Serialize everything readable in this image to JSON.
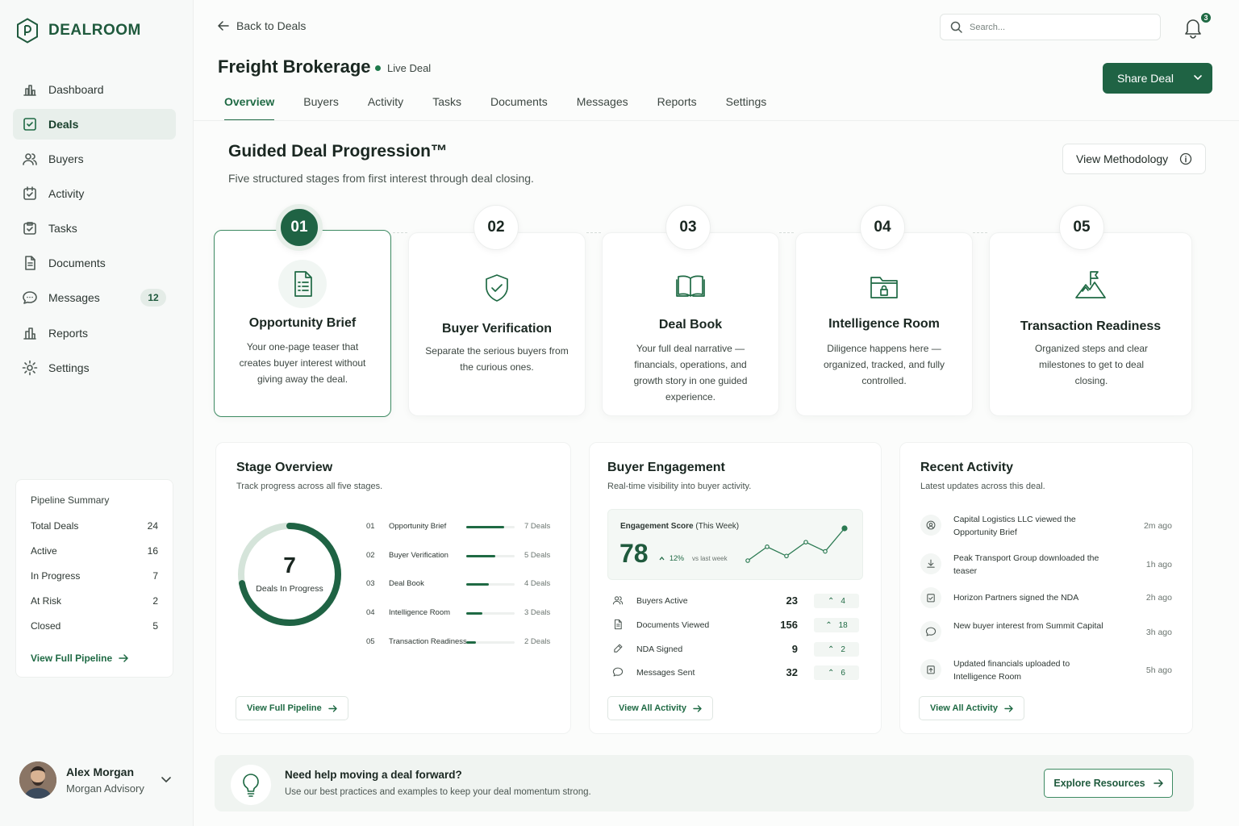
{
  "brand": {
    "name": "DEALROOM"
  },
  "sidebar": {
    "items": [
      {
        "label": "Dashboard",
        "icon": "chart-icon"
      },
      {
        "label": "Deals",
        "icon": "deal-check-icon",
        "active": true
      },
      {
        "label": "Buyers",
        "icon": "users-icon"
      },
      {
        "label": "Activity",
        "icon": "activity-icon"
      },
      {
        "label": "Tasks",
        "icon": "tasks-icon"
      },
      {
        "label": "Documents",
        "icon": "document-icon"
      },
      {
        "label": "Messages",
        "icon": "message-icon",
        "badge": "12"
      },
      {
        "label": "Reports",
        "icon": "reports-icon"
      },
      {
        "label": "Settings",
        "icon": "gear-icon"
      }
    ],
    "pipeline": {
      "title": "Pipeline Summary",
      "rows": [
        {
          "label": "Total Deals",
          "value": "24"
        },
        {
          "label": "Active",
          "value": "16"
        },
        {
          "label": "In Progress",
          "value": "7"
        },
        {
          "label": "At Risk",
          "value": "2"
        },
        {
          "label": "Closed",
          "value": "5"
        }
      ],
      "link": "View Full Pipeline"
    },
    "user": {
      "name": "Alex Morgan",
      "org": "Morgan Advisory"
    }
  },
  "header": {
    "back": "Back to Deals",
    "search_placeholder": "Search...",
    "notifications": "3",
    "title": "Freight Brokerage",
    "status": "Live Deal",
    "share": "Share Deal",
    "tabs": [
      "Overview",
      "Buyers",
      "Activity",
      "Tasks",
      "Documents",
      "Messages",
      "Reports",
      "Settings"
    ],
    "active_tab": "Overview"
  },
  "guided": {
    "title": "Guided Deal Progression™",
    "subtitle": "Five structured stages from first interest through deal closing.",
    "methodology": "View Methodology",
    "stages": [
      {
        "num": "01",
        "name": "Opportunity Brief",
        "desc": "Your one-page teaser that creates buyer interest without giving away the deal.",
        "icon": "brief-document-icon"
      },
      {
        "num": "02",
        "name": "Buyer Verification",
        "desc": "Separate the serious buyers from the curious ones.",
        "icon": "shield-check-icon"
      },
      {
        "num": "03",
        "name": "Deal Book",
        "desc": "Your full deal narrative — financials, operations, and growth story in one guided experience.",
        "icon": "open-book-icon"
      },
      {
        "num": "04",
        "name": "Intelligence Room",
        "desc": "Diligence happens here — organized, tracked, and fully controlled.",
        "icon": "locked-folder-icon"
      },
      {
        "num": "05",
        "name": "Transaction Readiness",
        "desc": "Organized steps and clear milestones to get to deal closing.",
        "icon": "mountain-flag-icon"
      }
    ]
  },
  "stage_overview": {
    "title": "Stage Overview",
    "subtitle": "Track progress across all five stages.",
    "donut": {
      "value": "7",
      "label": "Deals In Progress",
      "fraction": 0.72
    },
    "rows": [
      {
        "num": "01",
        "label": "Opportunity Brief",
        "count": "7 Deals",
        "fraction": 0.78
      },
      {
        "num": "02",
        "label": "Buyer Verification",
        "count": "5 Deals",
        "fraction": 0.6
      },
      {
        "num": "03",
        "label": "Deal Book",
        "count": "4 Deals",
        "fraction": 0.47
      },
      {
        "num": "04",
        "label": "Intelligence Room",
        "count": "3 Deals",
        "fraction": 0.33
      },
      {
        "num": "05",
        "label": "Transaction Readiness",
        "count": "2 Deals",
        "fraction": 0.2
      }
    ],
    "link": "View Full Pipeline"
  },
  "engagement": {
    "title": "Buyer Engagement",
    "subtitle": "Real-time visibility into buyer activity.",
    "score_label": "Engagement Score",
    "score_period": "(This Week)",
    "score": "78",
    "delta": "12%",
    "delta_label": "vs last week",
    "trend": [
      2,
      5,
      3,
      6,
      4,
      9
    ],
    "rows": [
      {
        "label": "Buyers Active",
        "value": "23",
        "delta": "4",
        "icon": "users-icon"
      },
      {
        "label": "Documents Viewed",
        "value": "156",
        "delta": "18",
        "icon": "document-icon"
      },
      {
        "label": "NDA Signed",
        "value": "9",
        "delta": "2",
        "icon": "pen-icon"
      },
      {
        "label": "Messages Sent",
        "value": "32",
        "delta": "6",
        "icon": "message-icon"
      }
    ],
    "link": "View All Activity"
  },
  "recent": {
    "title": "Recent Activity",
    "subtitle": "Latest updates across this deal.",
    "items": [
      {
        "text": "Capital Logistics LLC viewed the Opportunity Brief",
        "time": "2m ago",
        "icon": "view-icon"
      },
      {
        "text": "Peak Transport Group downloaded the teaser",
        "time": "1h ago",
        "icon": "download-icon"
      },
      {
        "text": "Horizon Partners signed the NDA",
        "time": "2h ago",
        "icon": "signed-icon"
      },
      {
        "text": "New buyer interest from Summit Capital",
        "time": "3h ago",
        "icon": "message-icon"
      },
      {
        "text": "Updated financials uploaded to Intelligence Room",
        "time": "5h ago",
        "icon": "upload-icon"
      }
    ],
    "link": "View All Activity"
  },
  "help": {
    "title": "Need help moving a deal forward?",
    "subtitle": "Use our best practices and examples to keep your deal momentum strong.",
    "button": "Explore Resources"
  },
  "colors": {
    "accent": "#1f6344",
    "accent_light": "#e8efeb"
  }
}
